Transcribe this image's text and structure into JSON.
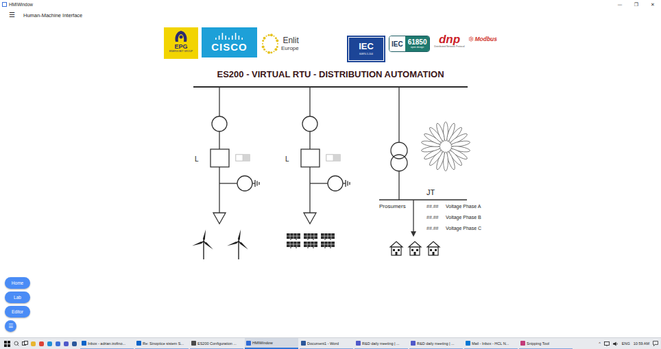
{
  "window": {
    "title": "HMIWindow",
    "controls": [
      "—",
      "❐",
      "✕"
    ]
  },
  "app_bar": {
    "menu_icon": "☰",
    "title": "Human-Machine Interface"
  },
  "logos": {
    "partners": [
      {
        "kind": "epg",
        "text": "EPG",
        "subtitle": "ENERGOBIT GROUP"
      },
      {
        "kind": "cisco",
        "text": "CISCO"
      },
      {
        "kind": "enlit",
        "text": "Enlit",
        "subtitle": "Europe"
      }
    ],
    "protocols": [
      {
        "kind": "iec",
        "text": "IEC",
        "subtitle": "60870-5-104"
      },
      {
        "kind": "iec61850",
        "text": "IEC",
        "number": "61850",
        "subtitle": "open design"
      },
      {
        "kind": "dnp",
        "text": "dnp",
        "subtitle": "Distributed Network Protocol"
      },
      {
        "kind": "modbus",
        "text": "Modbus"
      }
    ]
  },
  "diagram": {
    "title": "ES200 - VIRTUAL RTU - DISTRIBUTION AUTOMATION",
    "feeders": [
      {
        "label": "L",
        "switch_on": false,
        "kind": "wind"
      },
      {
        "label": "L",
        "switch_on": false,
        "kind": "solar"
      }
    ],
    "transformer": {
      "bus_label": "JT",
      "load_label": "Prosumers",
      "readings": [
        {
          "value": "##.##",
          "label": "Voltage Phase A"
        },
        {
          "value": "##.##",
          "label": "Voltage Phase B"
        },
        {
          "value": "##.##",
          "label": "Voltage Phase C"
        }
      ]
    }
  },
  "nav_buttons": [
    {
      "label": "Home",
      "kind": "pill"
    },
    {
      "label": "Lab",
      "kind": "pill"
    },
    {
      "label": "Editor",
      "kind": "pill"
    },
    {
      "label": "☰",
      "kind": "round"
    }
  ],
  "taskbar": {
    "pinned": [
      {
        "kind": "explorer"
      },
      {
        "kind": "chrome"
      },
      {
        "kind": "edge"
      },
      {
        "kind": "store"
      },
      {
        "kind": "teams"
      },
      {
        "kind": "word"
      }
    ],
    "apps": [
      {
        "label": "Inbox - adrian.trofino...",
        "kind": "outlook",
        "active": false
      },
      {
        "label": "Re: Sinoptice sistem S...",
        "kind": "outlook",
        "active": false
      },
      {
        "label": "ES200 Configuration ...",
        "kind": "config",
        "active": false
      },
      {
        "label": "HMIWindow",
        "kind": "hmi",
        "active": true
      },
      {
        "label": "Document1 - Word",
        "kind": "word",
        "active": false
      },
      {
        "label": "R&D daily meeting | ...",
        "kind": "teams",
        "active": false
      },
      {
        "label": "R&D daily meeting | ...",
        "kind": "teams",
        "active": false
      },
      {
        "label": "Mail - Inbox - HCL N...",
        "kind": "mail",
        "active": false
      },
      {
        "label": "Snipping Tool",
        "kind": "snip",
        "active": false
      }
    ],
    "tray": {
      "chevron": "^",
      "language": "ENG",
      "time": "10:59 AM"
    }
  }
}
